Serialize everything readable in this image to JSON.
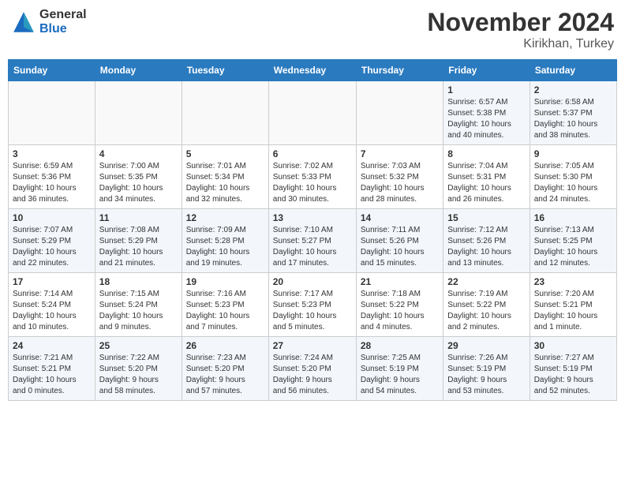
{
  "header": {
    "logo_general": "General",
    "logo_blue": "Blue",
    "month_title": "November 2024",
    "location": "Kirikhan, Turkey"
  },
  "weekdays": [
    "Sunday",
    "Monday",
    "Tuesday",
    "Wednesday",
    "Thursday",
    "Friday",
    "Saturday"
  ],
  "weeks": [
    [
      {
        "day": "",
        "info": ""
      },
      {
        "day": "",
        "info": ""
      },
      {
        "day": "",
        "info": ""
      },
      {
        "day": "",
        "info": ""
      },
      {
        "day": "",
        "info": ""
      },
      {
        "day": "1",
        "info": "Sunrise: 6:57 AM\nSunset: 5:38 PM\nDaylight: 10 hours\nand 40 minutes."
      },
      {
        "day": "2",
        "info": "Sunrise: 6:58 AM\nSunset: 5:37 PM\nDaylight: 10 hours\nand 38 minutes."
      }
    ],
    [
      {
        "day": "3",
        "info": "Sunrise: 6:59 AM\nSunset: 5:36 PM\nDaylight: 10 hours\nand 36 minutes."
      },
      {
        "day": "4",
        "info": "Sunrise: 7:00 AM\nSunset: 5:35 PM\nDaylight: 10 hours\nand 34 minutes."
      },
      {
        "day": "5",
        "info": "Sunrise: 7:01 AM\nSunset: 5:34 PM\nDaylight: 10 hours\nand 32 minutes."
      },
      {
        "day": "6",
        "info": "Sunrise: 7:02 AM\nSunset: 5:33 PM\nDaylight: 10 hours\nand 30 minutes."
      },
      {
        "day": "7",
        "info": "Sunrise: 7:03 AM\nSunset: 5:32 PM\nDaylight: 10 hours\nand 28 minutes."
      },
      {
        "day": "8",
        "info": "Sunrise: 7:04 AM\nSunset: 5:31 PM\nDaylight: 10 hours\nand 26 minutes."
      },
      {
        "day": "9",
        "info": "Sunrise: 7:05 AM\nSunset: 5:30 PM\nDaylight: 10 hours\nand 24 minutes."
      }
    ],
    [
      {
        "day": "10",
        "info": "Sunrise: 7:07 AM\nSunset: 5:29 PM\nDaylight: 10 hours\nand 22 minutes."
      },
      {
        "day": "11",
        "info": "Sunrise: 7:08 AM\nSunset: 5:29 PM\nDaylight: 10 hours\nand 21 minutes."
      },
      {
        "day": "12",
        "info": "Sunrise: 7:09 AM\nSunset: 5:28 PM\nDaylight: 10 hours\nand 19 minutes."
      },
      {
        "day": "13",
        "info": "Sunrise: 7:10 AM\nSunset: 5:27 PM\nDaylight: 10 hours\nand 17 minutes."
      },
      {
        "day": "14",
        "info": "Sunrise: 7:11 AM\nSunset: 5:26 PM\nDaylight: 10 hours\nand 15 minutes."
      },
      {
        "day": "15",
        "info": "Sunrise: 7:12 AM\nSunset: 5:26 PM\nDaylight: 10 hours\nand 13 minutes."
      },
      {
        "day": "16",
        "info": "Sunrise: 7:13 AM\nSunset: 5:25 PM\nDaylight: 10 hours\nand 12 minutes."
      }
    ],
    [
      {
        "day": "17",
        "info": "Sunrise: 7:14 AM\nSunset: 5:24 PM\nDaylight: 10 hours\nand 10 minutes."
      },
      {
        "day": "18",
        "info": "Sunrise: 7:15 AM\nSunset: 5:24 PM\nDaylight: 10 hours\nand 9 minutes."
      },
      {
        "day": "19",
        "info": "Sunrise: 7:16 AM\nSunset: 5:23 PM\nDaylight: 10 hours\nand 7 minutes."
      },
      {
        "day": "20",
        "info": "Sunrise: 7:17 AM\nSunset: 5:23 PM\nDaylight: 10 hours\nand 5 minutes."
      },
      {
        "day": "21",
        "info": "Sunrise: 7:18 AM\nSunset: 5:22 PM\nDaylight: 10 hours\nand 4 minutes."
      },
      {
        "day": "22",
        "info": "Sunrise: 7:19 AM\nSunset: 5:22 PM\nDaylight: 10 hours\nand 2 minutes."
      },
      {
        "day": "23",
        "info": "Sunrise: 7:20 AM\nSunset: 5:21 PM\nDaylight: 10 hours\nand 1 minute."
      }
    ],
    [
      {
        "day": "24",
        "info": "Sunrise: 7:21 AM\nSunset: 5:21 PM\nDaylight: 10 hours\nand 0 minutes."
      },
      {
        "day": "25",
        "info": "Sunrise: 7:22 AM\nSunset: 5:20 PM\nDaylight: 9 hours\nand 58 minutes."
      },
      {
        "day": "26",
        "info": "Sunrise: 7:23 AM\nSunset: 5:20 PM\nDaylight: 9 hours\nand 57 minutes."
      },
      {
        "day": "27",
        "info": "Sunrise: 7:24 AM\nSunset: 5:20 PM\nDaylight: 9 hours\nand 56 minutes."
      },
      {
        "day": "28",
        "info": "Sunrise: 7:25 AM\nSunset: 5:19 PM\nDaylight: 9 hours\nand 54 minutes."
      },
      {
        "day": "29",
        "info": "Sunrise: 7:26 AM\nSunset: 5:19 PM\nDaylight: 9 hours\nand 53 minutes."
      },
      {
        "day": "30",
        "info": "Sunrise: 7:27 AM\nSunset: 5:19 PM\nDaylight: 9 hours\nand 52 minutes."
      }
    ]
  ]
}
